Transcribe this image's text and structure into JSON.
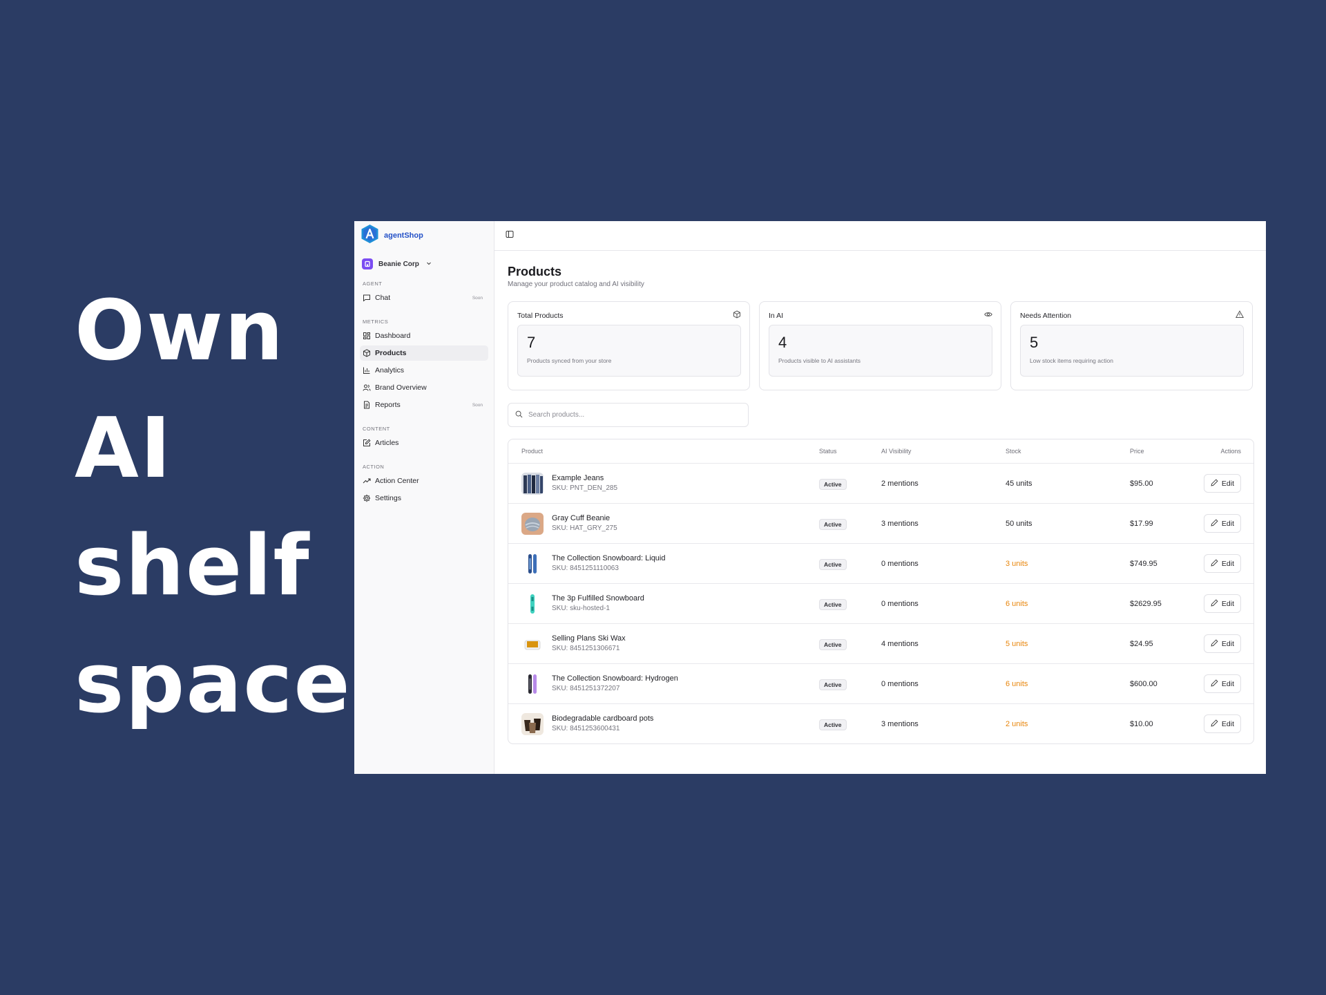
{
  "headline": [
    "Own",
    "AI",
    "shelf",
    "space"
  ],
  "app": {
    "brand": {
      "name": "agentShop",
      "logo_color": "#1f8fd8"
    },
    "org": {
      "name": "Beanie Corp",
      "badge_color": "#7b4cf2"
    },
    "sidebar": {
      "groups": [
        {
          "label": "AGENT",
          "items": [
            {
              "label": "Chat",
              "icon": "chat-icon",
              "tag": "Soon"
            }
          ]
        },
        {
          "label": "METRICS",
          "items": [
            {
              "label": "Dashboard",
              "icon": "dashboard-icon"
            },
            {
              "label": "Products",
              "icon": "box-icon",
              "active": true
            },
            {
              "label": "Analytics",
              "icon": "bar-chart-icon"
            },
            {
              "label": "Brand Overview",
              "icon": "users-icon"
            },
            {
              "label": "Reports",
              "icon": "document-icon",
              "tag": "Soon"
            }
          ]
        },
        {
          "label": "CONTENT",
          "items": [
            {
              "label": "Articles",
              "icon": "edit-icon"
            }
          ]
        },
        {
          "label": "ACTION",
          "items": [
            {
              "label": "Action Center",
              "icon": "trend-icon"
            },
            {
              "label": "Settings",
              "icon": "gear-icon"
            }
          ]
        }
      ]
    },
    "page": {
      "title": "Products",
      "subtitle": "Manage your product catalog and AI visibility"
    },
    "stats": [
      {
        "label": "Total Products",
        "value": "7",
        "desc": "Products synced from your store",
        "icon": "box-icon"
      },
      {
        "label": "In AI",
        "value": "4",
        "desc": "Products visible to AI assistants",
        "icon": "eye-icon"
      },
      {
        "label": "Needs Attention",
        "value": "5",
        "desc": "Low stock items requiring action",
        "icon": "alert-icon"
      }
    ],
    "search": {
      "placeholder": "Search products..."
    },
    "table": {
      "columns": {
        "product": "Product",
        "status": "Status",
        "visibility": "AI Visibility",
        "stock": "Stock",
        "price": "Price",
        "actions": "Actions"
      },
      "edit_label": "Edit",
      "low_stock_color": "#e8850a",
      "rows": [
        {
          "name": "Example Jeans",
          "sku": "SKU: PNT_DEN_285",
          "status": "Active",
          "visibility": "2 mentions",
          "stock": "45 units",
          "low": false,
          "price": "$95.00",
          "thumb": "jeans"
        },
        {
          "name": "Gray Cuff Beanie",
          "sku": "SKU: HAT_GRY_275",
          "status": "Active",
          "visibility": "3 mentions",
          "stock": "50 units",
          "low": false,
          "price": "$17.99",
          "thumb": "beanie"
        },
        {
          "name": "The Collection Snowboard: Liquid",
          "sku": "SKU: 8451251110063",
          "status": "Active",
          "visibility": "0 mentions",
          "stock": "3 units",
          "low": true,
          "price": "$749.95",
          "thumb": "snowboard-blue"
        },
        {
          "name": "The 3p Fulfilled Snowboard",
          "sku": "SKU: sku-hosted-1",
          "status": "Active",
          "visibility": "0 mentions",
          "stock": "6 units",
          "low": true,
          "price": "$2629.95",
          "thumb": "snowboard-teal"
        },
        {
          "name": "Selling Plans Ski Wax",
          "sku": "SKU: 8451251306671",
          "status": "Active",
          "visibility": "4 mentions",
          "stock": "5 units",
          "low": true,
          "price": "$24.95",
          "thumb": "wax"
        },
        {
          "name": "The Collection Snowboard: Hydrogen",
          "sku": "SKU: 8451251372207",
          "status": "Active",
          "visibility": "0 mentions",
          "stock": "6 units",
          "low": true,
          "price": "$600.00",
          "thumb": "snowboard-purple"
        },
        {
          "name": "Biodegradable cardboard pots",
          "sku": "SKU: 8451253600431",
          "status": "Active",
          "visibility": "3 mentions",
          "stock": "2 units",
          "low": true,
          "price": "$10.00",
          "thumb": "pots"
        }
      ]
    }
  }
}
